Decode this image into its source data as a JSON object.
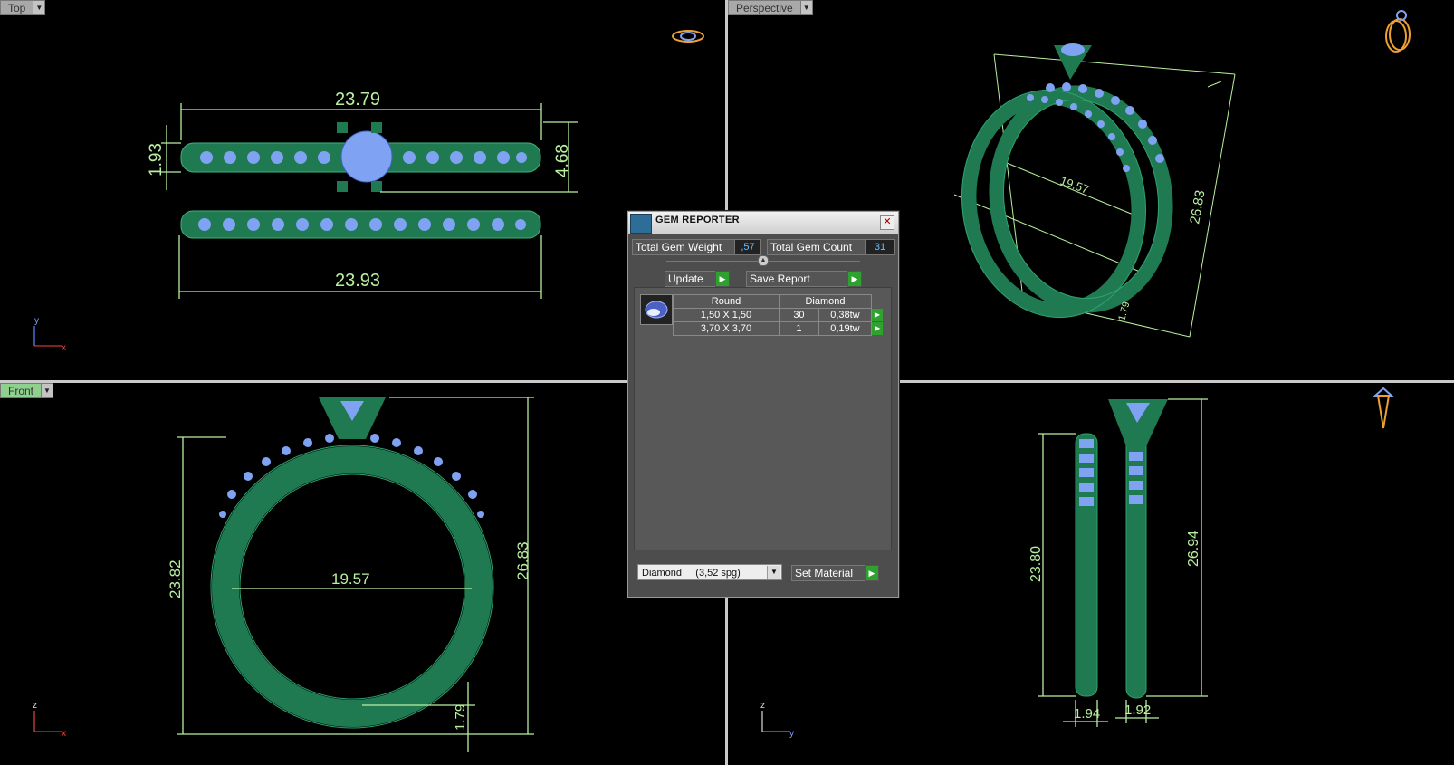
{
  "viewports": {
    "top": {
      "label": "Top"
    },
    "perspective": {
      "label": "Perspective"
    },
    "front": {
      "label": "Front"
    },
    "right": {
      "label": ""
    }
  },
  "dimensions": {
    "top_upper_width": "23.79",
    "top_lower_width": "23.93",
    "top_left_height": "1.93",
    "top_right_height": "4.68",
    "persp_diameter": "19.57",
    "persp_height": "26.83",
    "persp_small": "1.79",
    "front_inner_diameter": "19.57",
    "front_left_height": "23.82",
    "front_right_height": "26.83",
    "front_bottom_thickness": "1.79",
    "side_left_height": "23.80",
    "side_right_height": "26.94",
    "side_left_width": "1.94",
    "side_right_width": "1.92"
  },
  "axes": {
    "top": {
      "vertical": "y",
      "horizontal": "x"
    },
    "front": {
      "vertical": "z",
      "horizontal": "x"
    },
    "right": {
      "vertical": "z",
      "horizontal": "y"
    }
  },
  "dialog": {
    "title": "GEM REPORTER",
    "total_weight_label": "Total Gem Weight",
    "total_weight_value": ",57",
    "total_count_label": "Total Gem Count",
    "total_count_value": "31",
    "update_label": "Update",
    "save_report_label": "Save Report",
    "table_headers": [
      "Round",
      "Diamond"
    ],
    "gems": [
      {
        "size": "1,50 X 1,50",
        "count": "30",
        "weight": "0,38tw"
      },
      {
        "size": "3,70 X 3,70",
        "count": "1",
        "weight": "0,19tw"
      }
    ],
    "material_selected": "Diamond     (3,52 spg)",
    "set_material_label": "Set Material"
  },
  "colors": {
    "ring_green": "#1f7a52",
    "gem_blue": "#7fa3f2",
    "dimension": "#b9f0a0",
    "active_label": "#8fd08f"
  }
}
